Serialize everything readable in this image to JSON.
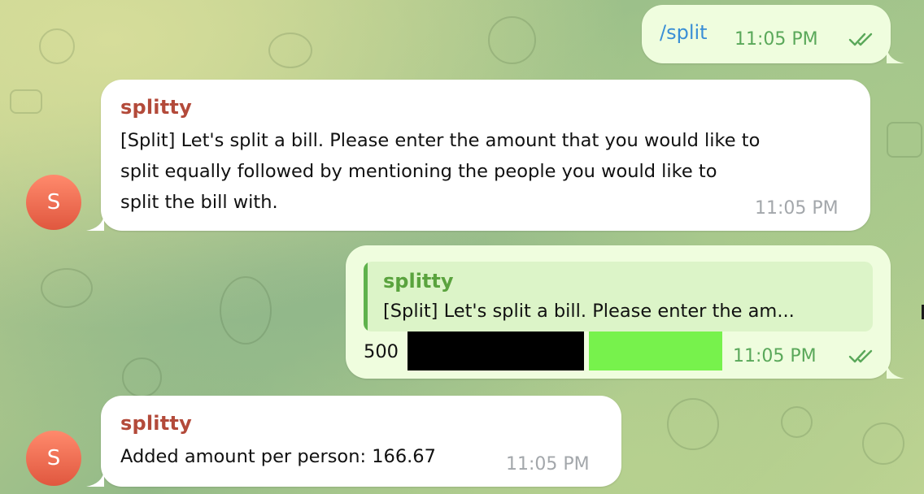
{
  "messages": [
    {
      "direction": "outgoing",
      "command": "/split",
      "time": "11:05 PM",
      "status": "read"
    },
    {
      "direction": "incoming",
      "sender": "splitty",
      "avatar_letter": "S",
      "lines": [
        "[Split] Let's split a bill. Please enter the amount that you would like to",
        "split equally followed by mentioning the people you would like to",
        "split the bill with."
      ],
      "time": "11:05 PM"
    },
    {
      "direction": "outgoing",
      "reply_to": {
        "sender": "splitty",
        "preview": "[Split] Let's split a bill. Please enter the am..."
      },
      "amount": "500",
      "time": "11:05 PM",
      "status": "read"
    },
    {
      "direction": "incoming",
      "sender": "splitty",
      "avatar_letter": "S",
      "text": "Added amount per person: 166.67",
      "time": "11:05 PM"
    }
  ],
  "colors": {
    "incoming_bubble": "#ffffff",
    "outgoing_bubble": "#effdde",
    "sender_name": "#b34a3a",
    "reply_name": "#5aa33e",
    "command_link": "#3a8fd6",
    "outgoing_time": "#5aa85a",
    "incoming_time": "#a3a7ab",
    "avatar": "#e96a50",
    "redaction_black": "#000000",
    "redaction_green": "#77f24c"
  },
  "icons": {
    "read_receipt": "double-check-icon"
  }
}
